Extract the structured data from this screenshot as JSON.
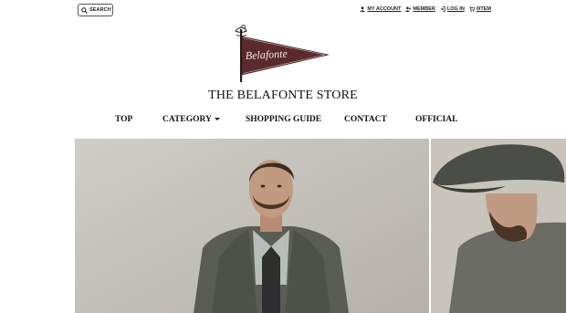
{
  "header": {
    "search_label": "SEARCH",
    "links": [
      {
        "label": "MY ACCOUNT",
        "icon": "user-icon"
      },
      {
        "label": "MEMBER",
        "icon": "user-plus-icon"
      },
      {
        "label": "LOG IN",
        "icon": "login-icon"
      },
      {
        "label": "0ITEM",
        "icon": "cart-icon"
      }
    ]
  },
  "logo": {
    "pennant_text": "Belafonte"
  },
  "store": {
    "title": "THE BELAFONTE STORE"
  },
  "nav": {
    "items": [
      {
        "label": "TOP"
      },
      {
        "label": "CATEGORY"
      },
      {
        "label": "SHOPPING GUIDE"
      },
      {
        "label": "CONTACT"
      },
      {
        "label": "OFFICIAL"
      }
    ]
  },
  "colors": {
    "pennant": "#5a2a2e",
    "text": "#111111",
    "hero_bg": "#c2beb7"
  }
}
